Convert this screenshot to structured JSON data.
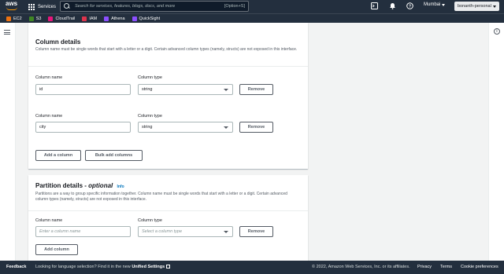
{
  "topnav": {
    "logo": "aws",
    "services_label": "Services",
    "search_placeholder": "Search for services, features, blogs, docs, and more",
    "search_shortcut": "[Option+S]",
    "region": "Mumbai",
    "account": "bonanth-personal"
  },
  "favorites": [
    {
      "label": "EC2",
      "color": "#ec7211"
    },
    {
      "label": "S3",
      "color": "#3f8624"
    },
    {
      "label": "CloudTrail",
      "color": "#e7157b"
    },
    {
      "label": "IAM",
      "color": "#dd344c"
    },
    {
      "label": "Athena",
      "color": "#8c4fff"
    },
    {
      "label": "QuickSight",
      "color": "#8c4fff"
    }
  ],
  "column_details": {
    "title": "Column details",
    "description": "Column name must be single words that start with a letter or a digit. Certain advanced column types (namely, structs) are not exposed in this interface.",
    "name_label": "Column name",
    "type_label": "Column type",
    "rows": [
      {
        "name": "id",
        "type": "string",
        "remove": "Remove"
      },
      {
        "name": "city",
        "type": "string",
        "remove": "Remove"
      }
    ],
    "add_column": "Add a column",
    "bulk_add": "Bulk add columns"
  },
  "partition_details": {
    "title": "Partition details -",
    "optional": "optional",
    "info": "Info",
    "description": "Partitions are a way to group specific information together. Column name must be single words that start with a letter or a digit. Certain advanced column types (namely, structs) are not exposed in this interface.",
    "name_label": "Column name",
    "type_label": "Column type",
    "name_placeholder": "Enter a column name",
    "type_placeholder": "Select a column type",
    "remove": "Remove",
    "add_column": "Add column"
  },
  "footer": {
    "feedback": "Feedback",
    "language_text": "Looking for language selection? Find it in the new",
    "unified_settings": "Unified Settings",
    "copyright": "© 2022, Amazon Web Services, Inc. or its affiliates.",
    "privacy": "Privacy",
    "terms": "Terms",
    "cookie": "Cookie preferences"
  }
}
